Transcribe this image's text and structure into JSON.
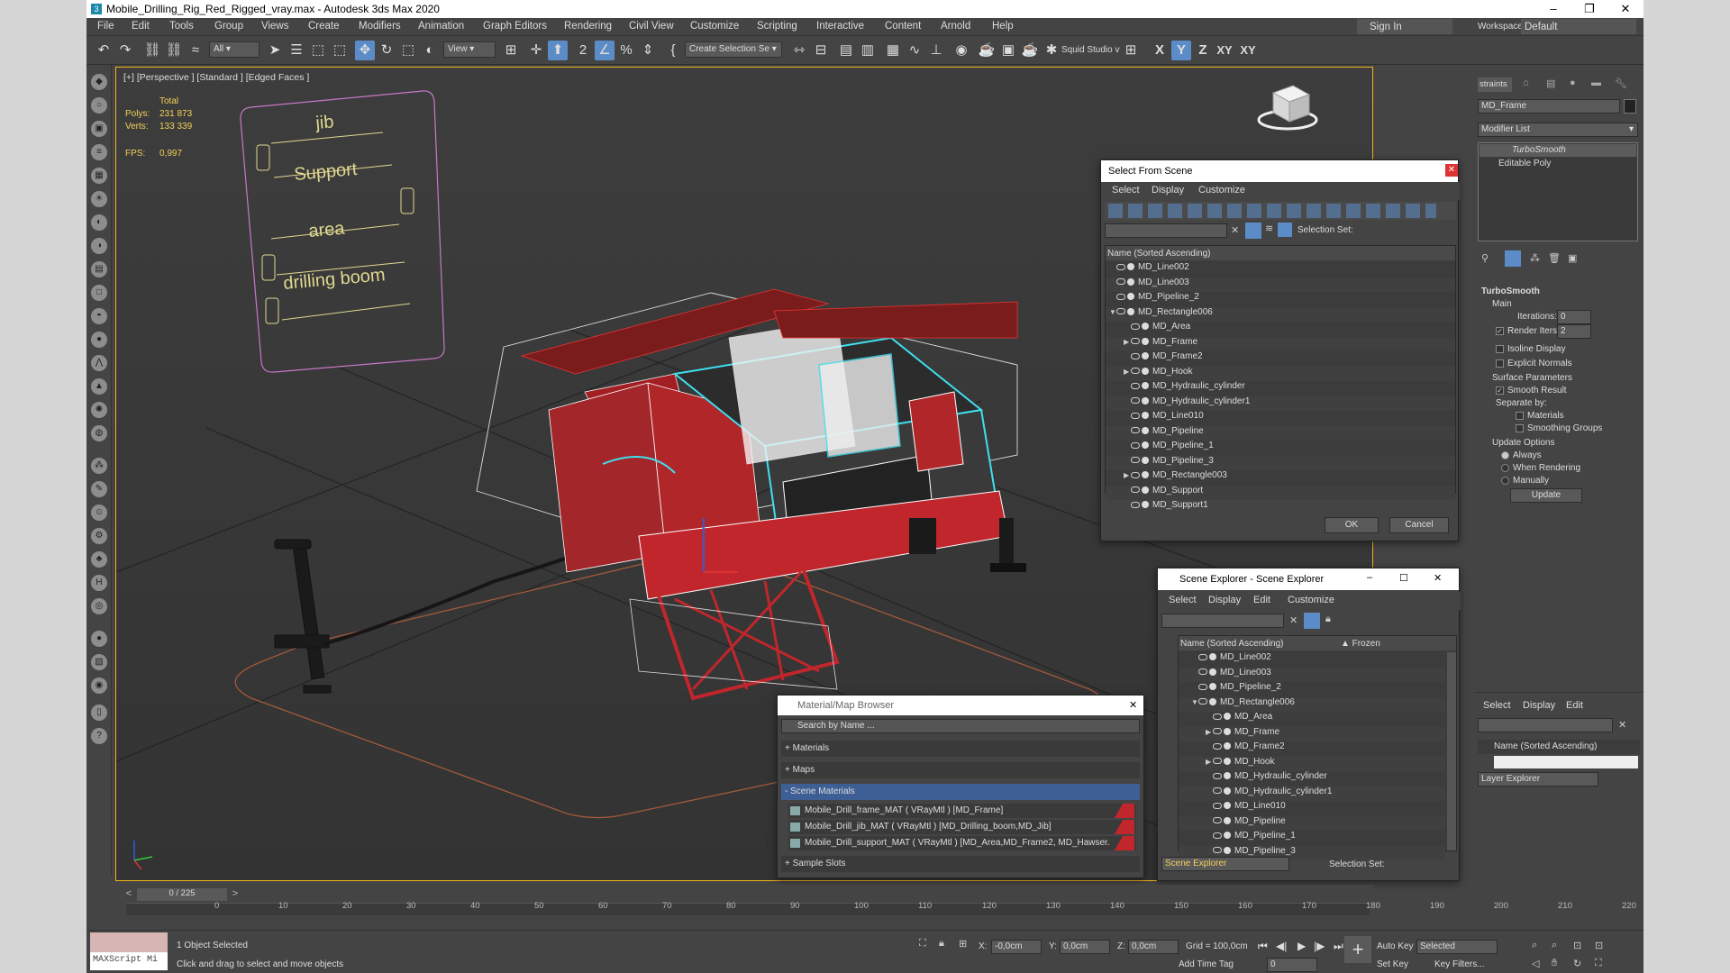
{
  "window": {
    "title": "Mobile_Drilling_Rig_Red_Rigged_vray.max - Autodesk 3ds Max 2020",
    "logo": "3"
  },
  "menu": [
    "File",
    "Edit",
    "Tools",
    "Group",
    "Views",
    "Create",
    "Modifiers",
    "Animation",
    "Graph Editors",
    "Rendering",
    "Civil View",
    "Customize",
    "Scripting",
    "Interactive",
    "Content",
    "Arnold",
    "Help"
  ],
  "signin": "Sign In",
  "workspaces_label": "Workspaces:",
  "workspace": "Default",
  "toolbar": {
    "filter": "All",
    "refcoord": "View",
    "named_sel": "Create Selection Se",
    "squid": "Squid Studio v",
    "axes": [
      "X",
      "Y",
      "Z",
      "XY",
      "XY"
    ]
  },
  "viewport": {
    "label": "[+] [Perspective ] [Standard ] [Edged Faces ]",
    "stats": {
      "total": "Total",
      "polys_label": "Polys:",
      "polys": "231 873",
      "verts_label": "Verts:",
      "verts": "133 339",
      "fps_label": "FPS:",
      "fps": "0,997"
    },
    "panel_labels": [
      "jib",
      "Support",
      "area",
      "drilling boom"
    ]
  },
  "select_scene": {
    "title": "Select From Scene",
    "menu": [
      "Select",
      "Display",
      "Customize"
    ],
    "selection_set": "Selection Set:",
    "header": "Name (Sorted Ascending)",
    "items": [
      {
        "name": "MD_Line002",
        "level": 0,
        "arrow": ""
      },
      {
        "name": "MD_Line003",
        "level": 0,
        "arrow": ""
      },
      {
        "name": "MD_Pipeline_2",
        "level": 0,
        "arrow": ""
      },
      {
        "name": "MD_Rectangle006",
        "level": 0,
        "arrow": "▼"
      },
      {
        "name": "MD_Area",
        "level": 1,
        "arrow": ""
      },
      {
        "name": "MD_Frame",
        "level": 1,
        "arrow": "▶"
      },
      {
        "name": "MD_Frame2",
        "level": 1,
        "arrow": ""
      },
      {
        "name": "MD_Hook",
        "level": 1,
        "arrow": "▶"
      },
      {
        "name": "MD_Hydraulic_cylinder",
        "level": 1,
        "arrow": ""
      },
      {
        "name": "MD_Hydraulic_cylinder1",
        "level": 1,
        "arrow": ""
      },
      {
        "name": "MD_Line010",
        "level": 1,
        "arrow": ""
      },
      {
        "name": "MD_Pipeline",
        "level": 1,
        "arrow": ""
      },
      {
        "name": "MD_Pipeline_1",
        "level": 1,
        "arrow": ""
      },
      {
        "name": "MD_Pipeline_3",
        "level": 1,
        "arrow": ""
      },
      {
        "name": "MD_Rectangle003",
        "level": 1,
        "arrow": "▶"
      },
      {
        "name": "MD_Support",
        "level": 1,
        "arrow": ""
      },
      {
        "name": "MD_Support1",
        "level": 1,
        "arrow": ""
      }
    ],
    "ok": "OK",
    "cancel": "Cancel"
  },
  "scene_explorer": {
    "title": "Scene Explorer - Scene Explorer",
    "menu": [
      "Select",
      "Display",
      "Edit",
      "Customize"
    ],
    "header": "Name (Sorted Ascending)",
    "frozen": "▲ Frozen",
    "items": [
      {
        "name": "MD_Line002",
        "level": 0,
        "arrow": ""
      },
      {
        "name": "MD_Line003",
        "level": 0,
        "arrow": ""
      },
      {
        "name": "MD_Pipeline_2",
        "level": 0,
        "arrow": ""
      },
      {
        "name": "MD_Rectangle006",
        "level": 0,
        "arrow": "▼"
      },
      {
        "name": "MD_Area",
        "level": 1,
        "arrow": ""
      },
      {
        "name": "MD_Frame",
        "level": 1,
        "arrow": "▶"
      },
      {
        "name": "MD_Frame2",
        "level": 1,
        "arrow": ""
      },
      {
        "name": "MD_Hook",
        "level": 1,
        "arrow": "▶"
      },
      {
        "name": "MD_Hydraulic_cylinder",
        "level": 1,
        "arrow": ""
      },
      {
        "name": "MD_Hydraulic_cylinder1",
        "level": 1,
        "arrow": ""
      },
      {
        "name": "MD_Line010",
        "level": 1,
        "arrow": ""
      },
      {
        "name": "MD_Pipeline",
        "level": 1,
        "arrow": ""
      },
      {
        "name": "MD_Pipeline_1",
        "level": 1,
        "arrow": ""
      },
      {
        "name": "MD_Pipeline_3",
        "level": 1,
        "arrow": ""
      }
    ],
    "footer_label": "Scene Explorer",
    "selection_set": "Selection Set:"
  },
  "mat_browser": {
    "title": "Material/Map Browser",
    "search": "Search by Name ...",
    "materials": "+ Materials",
    "maps": "+ Maps",
    "scene_materials": "- Scene Materials",
    "sample_slots": "+ Sample Slots",
    "items": [
      "Mobile_Drill_frame_MAT ( VRayMtl ) [MD_Frame]",
      "Mobile_Drill_jib_MAT ( VRayMtl ) [MD_Drilling_boom,MD_Jib]",
      "Mobile_Drill_support_MAT ( VRayMtl ) [MD_Area,MD_Frame2, MD_Hawser..."
    ]
  },
  "command_panel": {
    "tab": "straints",
    "object_name": "MD_Frame",
    "modifier_list": "Modifier List",
    "stack": [
      "TurboSmooth",
      "Editable Poly"
    ],
    "rollout": "TurboSmooth",
    "main": "Main",
    "iterations_label": "Iterations:",
    "iterations": "0",
    "render_iters_label": "Render Iters:",
    "render_iters": "2",
    "isoline": "Isoline Display",
    "explicit": "Explicit Normals",
    "surface": "Surface Parameters",
    "smooth_result": "Smooth Result",
    "separate": "Separate by:",
    "materials": "Materials",
    "smoothing": "Smoothing Groups",
    "update_options": "Update Options",
    "always": "Always",
    "when_rendering": "When Rendering",
    "manually": "Manually",
    "update": "Update",
    "lower_menu": [
      "Select",
      "Display",
      "Edit"
    ],
    "lower_header": "Name (Sorted Ascending)",
    "layer_explorer": "Layer Explorer"
  },
  "timeline": {
    "frame": "0 / 225",
    "ticks": [
      "0",
      "10",
      "20",
      "30",
      "40",
      "50",
      "60",
      "70",
      "80",
      "90",
      "100",
      "110",
      "120",
      "130",
      "140",
      "150",
      "160",
      "170",
      "180",
      "190",
      "200",
      "210",
      "220"
    ]
  },
  "status": {
    "maxscript": "MAXScript Mi",
    "selected": "1 Object Selected",
    "hint": "Click and drag to select and move objects",
    "x_label": "X:",
    "x": "-0,0cm",
    "y_label": "Y:",
    "y": "0,0cm",
    "z_label": "Z:",
    "z": "0,0cm",
    "grid": "Grid = 100,0cm",
    "add_time_tag": "Add Time Tag",
    "auto_key": "Auto Key",
    "selected_dd": "Selected",
    "set_key": "Set Key",
    "key_filters": "Key Filters...",
    "frame_value": "0"
  },
  "colors": {
    "accent": "#5b8cc7",
    "highlight": "#f3b31a",
    "select_cyan": "#3fe0ef",
    "red": "#c0262c"
  }
}
